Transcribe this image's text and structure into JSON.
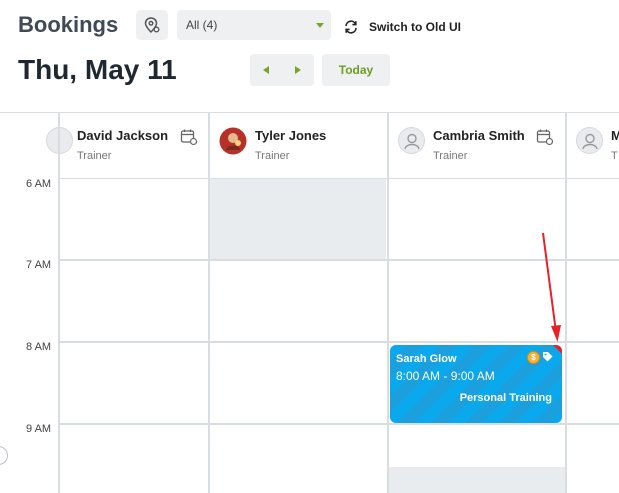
{
  "header": {
    "title": "Bookings",
    "location_filter": "All (4)",
    "switch_label": "Switch to Old UI",
    "date": "Thu, May 11",
    "today_label": "Today"
  },
  "staff": [
    {
      "name": "David Jackson",
      "role": "Trainer"
    },
    {
      "name": "Tyler Jones",
      "role": "Trainer"
    },
    {
      "name": "Cambria Smith",
      "role": "Trainer"
    },
    {
      "name": "M",
      "role": "T"
    }
  ],
  "times": [
    "6 AM",
    "7 AM",
    "8 AM",
    "9 AM"
  ],
  "event": {
    "client": "Sarah Glow",
    "time": "8:00 AM - 9:00 AM",
    "type": "Personal Training",
    "dollar_symbol": "$"
  },
  "colors": {
    "accent": "#7aa428",
    "event_blue": "#0aa8ec",
    "annotation": "#e8202a"
  },
  "icons": [
    "location-pin-icon",
    "refresh-icon",
    "calendar-settings-icon",
    "dollar-icon",
    "tag-icon",
    "user-icon"
  ]
}
